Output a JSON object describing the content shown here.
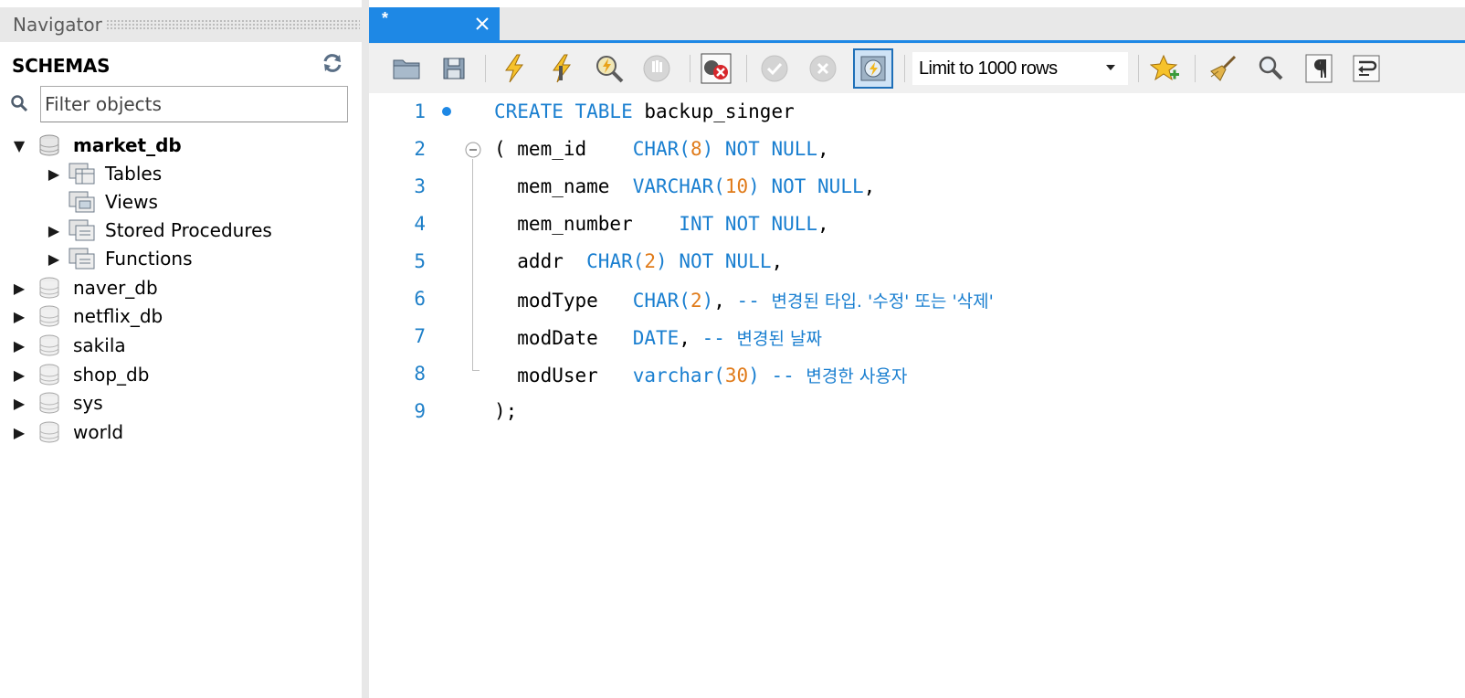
{
  "navigator": {
    "title": "Navigator",
    "schemas_label": "SCHEMAS",
    "filter_placeholder": "Filter objects",
    "tree": [
      {
        "label": "market_db",
        "expanded": true,
        "bold": true
      },
      {
        "label": "Tables"
      },
      {
        "label": "Views"
      },
      {
        "label": "Stored Procedures"
      },
      {
        "label": "Functions"
      },
      {
        "label": "naver_db"
      },
      {
        "label": "netflix_db"
      },
      {
        "label": "sakila"
      },
      {
        "label": "shop_db"
      },
      {
        "label": "sys"
      },
      {
        "label": "world"
      }
    ]
  },
  "editor": {
    "tab_title": "*",
    "limit_select": "Limit to 1000 rows",
    "toolbar_icons": [
      "open-file-icon",
      "save-icon",
      "execute-icon",
      "execute-current-icon",
      "explain-icon",
      "stop-icon",
      "error-toggle-icon",
      "commit-icon",
      "rollback-icon",
      "autocommit-icon",
      "bookmark-icon",
      "beautify-icon",
      "find-icon",
      "invisible-chars-icon",
      "wrap-icon"
    ],
    "code_lines": [
      {
        "n": "1",
        "tokens": [
          [
            "kw",
            "CREATE TABLE "
          ],
          [
            "id",
            "backup_singer"
          ]
        ]
      },
      {
        "n": "2",
        "tokens": [
          [
            "id",
            "( mem_id    "
          ],
          [
            "kw",
            "CHAR("
          ],
          [
            "num",
            "8"
          ],
          [
            "kw",
            ") NOT NULL"
          ],
          [
            "id",
            ","
          ]
        ]
      },
      {
        "n": "3",
        "tokens": [
          [
            "id",
            "  mem_name  "
          ],
          [
            "kw",
            "VARCHAR("
          ],
          [
            "num",
            "10"
          ],
          [
            "kw",
            ") NOT NULL"
          ],
          [
            "id",
            ","
          ]
        ]
      },
      {
        "n": "4",
        "tokens": [
          [
            "id",
            "  mem_number    "
          ],
          [
            "kw",
            "INT NOT NULL"
          ],
          [
            "id",
            ","
          ]
        ]
      },
      {
        "n": "5",
        "tokens": [
          [
            "id",
            "  addr  "
          ],
          [
            "kw",
            "CHAR("
          ],
          [
            "num",
            "2"
          ],
          [
            "kw",
            ") NOT NULL"
          ],
          [
            "id",
            ","
          ]
        ]
      },
      {
        "n": "6",
        "tokens": [
          [
            "id",
            "  modType   "
          ],
          [
            "kw",
            "CHAR("
          ],
          [
            "num",
            "2"
          ],
          [
            "kw",
            ")"
          ],
          [
            "id",
            ", "
          ],
          [
            "cmt",
            "-- "
          ],
          [
            "ct",
            "변경된 타입. '수정' 또는 '삭제'"
          ]
        ]
      },
      {
        "n": "7",
        "tokens": [
          [
            "id",
            "  modDate   "
          ],
          [
            "kw",
            "DATE"
          ],
          [
            "id",
            ", "
          ],
          [
            "cmt",
            "-- "
          ],
          [
            "ct",
            "변경된 날짜"
          ]
        ]
      },
      {
        "n": "8",
        "tokens": [
          [
            "id",
            "  modUser   "
          ],
          [
            "kw",
            "varchar("
          ],
          [
            "num",
            "30"
          ],
          [
            "kw",
            ")"
          ],
          [
            "id",
            " "
          ],
          [
            "cmt",
            "-- "
          ],
          [
            "ct",
            "변경한 사용자"
          ]
        ]
      },
      {
        "n": "9",
        "tokens": [
          [
            "id",
            ");"
          ]
        ]
      }
    ]
  },
  "colors": {
    "accent": "#1e88e5",
    "keyword": "#1a7fd0",
    "number": "#e07b1a",
    "panel_bg": "#e8e8e8"
  }
}
